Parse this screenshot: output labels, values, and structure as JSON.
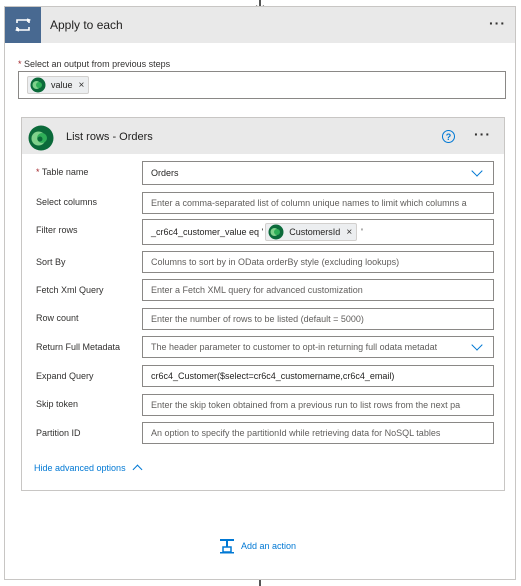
{
  "outer": {
    "title": "Apply to each",
    "select_label": "Select an output from previous steps",
    "token": "value"
  },
  "inner": {
    "title": "List rows - Orders",
    "help": "?",
    "rows": {
      "table_name": {
        "label": "Table name",
        "value": "Orders"
      },
      "select_columns": {
        "label": "Select columns",
        "placeholder": "Enter a comma-separated list of column unique names to limit which columns a"
      },
      "filter_rows": {
        "label": "Filter rows",
        "prefix": "_cr6c4_customer_value eq '",
        "token": "CustomersId",
        "suffix": "'"
      },
      "sort_by": {
        "label": "Sort By",
        "placeholder": "Columns to sort by in OData orderBy style (excluding lookups)"
      },
      "fetch_xml": {
        "label": "Fetch Xml Query",
        "placeholder": "Enter a Fetch XML query for advanced customization"
      },
      "row_count": {
        "label": "Row count",
        "placeholder": "Enter the number of rows to be listed (default = 5000)"
      },
      "return_metadata": {
        "label": "Return Full Metadata",
        "placeholder": "The header parameter to customer to opt-in returning full odata metadat"
      },
      "expand_query": {
        "label": "Expand Query",
        "value": "cr6c4_Customer($select=cr6c4_customername,cr6c4_email)"
      },
      "skip_token": {
        "label": "Skip token",
        "placeholder": "Enter the skip token obtained from a previous run to list rows from the next pa"
      },
      "partition_id": {
        "label": "Partition ID",
        "placeholder": "An option to specify the partitionId while retrieving data for NoSQL tables"
      }
    },
    "hide_advanced": "Hide advanced options"
  },
  "add_action": "Add an action",
  "colors": {
    "loop_icon_bg": "#486991",
    "header_bg": "#e9e9e9",
    "link": "#0078d4",
    "required": "#a4262c",
    "dataverse_green": "#1f8a47"
  },
  "icons": {
    "loop": "loop-icon",
    "dataverse": "dataverse-icon",
    "help": "help-icon",
    "chevron": "chevron-down-icon",
    "add": "add-action-icon"
  }
}
